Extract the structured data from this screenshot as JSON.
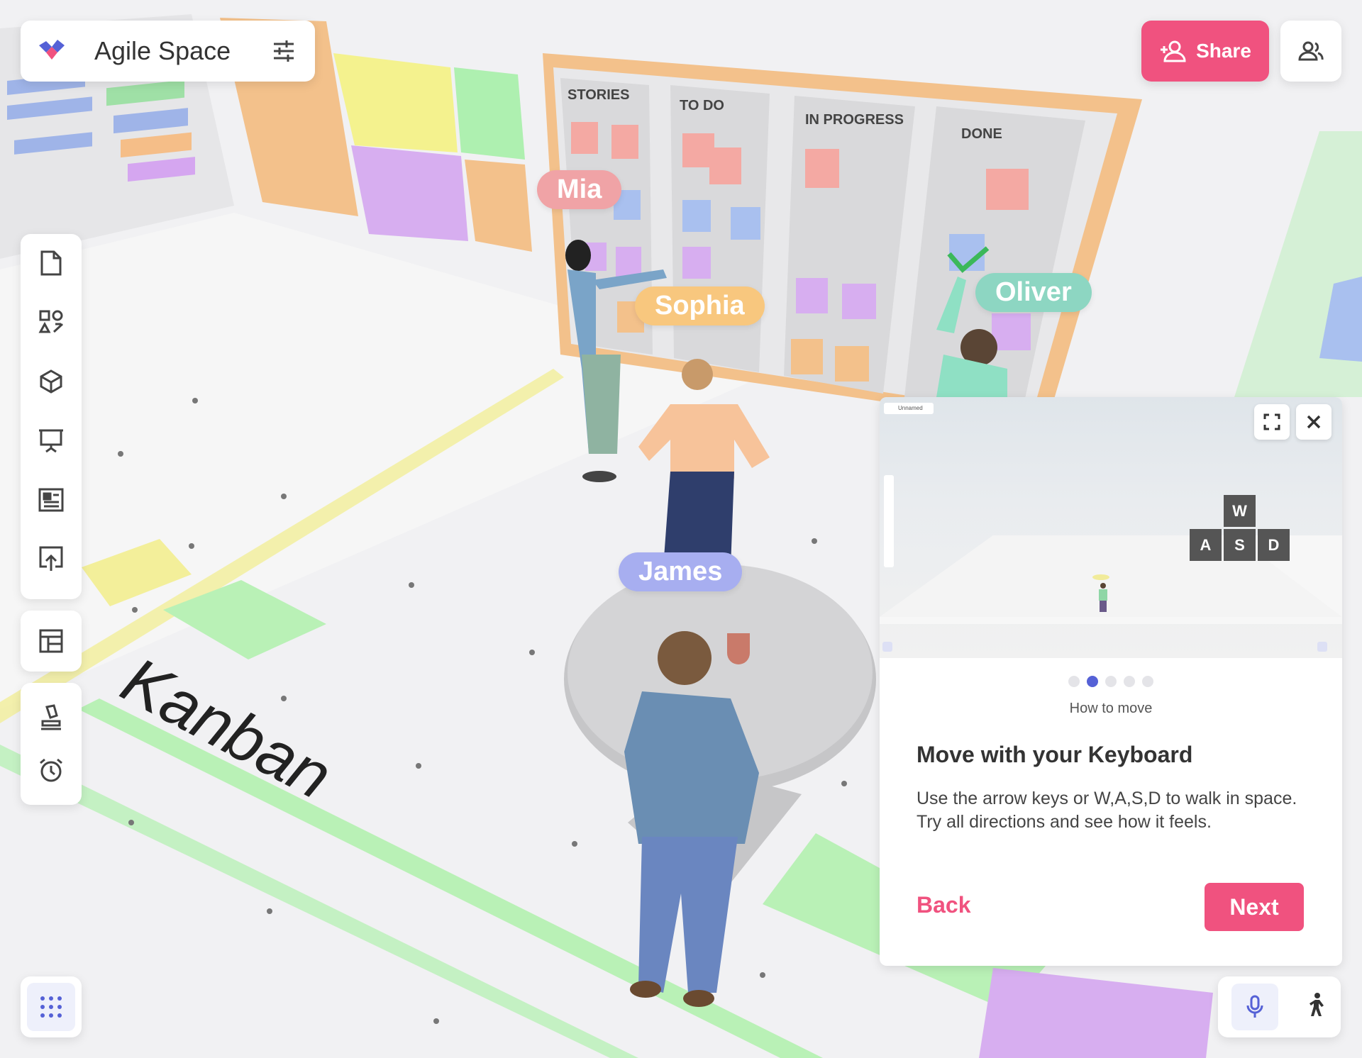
{
  "app": {
    "title": "Agile Space",
    "accent_color": "#f0527f",
    "brand_color": "#5561d6"
  },
  "header": {
    "share_label": "Share",
    "users_icon": "users-icon",
    "settings_icon": "sliders-icon"
  },
  "toolbar": {
    "tools": [
      "document-icon",
      "shapes-icon",
      "cube-icon",
      "presentation-icon",
      "newspaper-icon",
      "upload-icon"
    ],
    "layout_tool": "layout-icon",
    "bottom_tools": [
      "stamp-icon",
      "timer-icon"
    ]
  },
  "scene": {
    "zone_label": "Kanban",
    "kanban_columns": [
      "STORIES",
      "TO DO",
      "IN PROGRESS",
      "DONE"
    ],
    "avatars": [
      {
        "name": "Mia",
        "color": "#f0a3a6"
      },
      {
        "name": "Sophia",
        "color": "#f8c77e"
      },
      {
        "name": "Oliver",
        "color": "#8dd6c2"
      },
      {
        "name": "James",
        "color": "#a7aef0"
      }
    ]
  },
  "tutorial": {
    "preview_title": "Unnamed",
    "keys": [
      "W",
      "A",
      "S",
      "D"
    ],
    "step_label": "How to move",
    "heading": "Move with your Keyboard",
    "body": "Use the arrow keys or W,A,S,D to walk in space. Try all directions and see how it feels.",
    "back_label": "Back",
    "next_label": "Next",
    "total_steps": 5,
    "current_step": 2
  },
  "bottom": {
    "apps_icon": "grid-icon",
    "mic_icon": "microphone-icon",
    "walk_icon": "walk-icon"
  }
}
